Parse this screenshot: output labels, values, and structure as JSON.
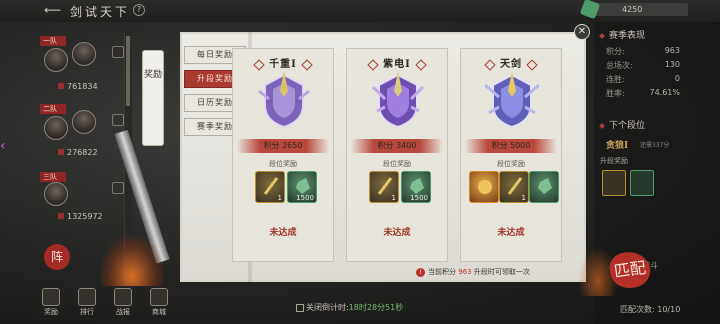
{
  "header": {
    "title": "剑试天下",
    "currency_value": "4250"
  },
  "teams": [
    {
      "tag": "一队",
      "score": "761834"
    },
    {
      "tag": "二队",
      "score": "276822"
    },
    {
      "tag": "三队",
      "score": "1325972"
    }
  ],
  "bottom_nav": [
    "奖励",
    "排行",
    "战报",
    "商城"
  ],
  "side_tab": {
    "label": "奖励"
  },
  "left_seal": "阵",
  "menu": [
    {
      "label": "每日奖励",
      "active": false
    },
    {
      "label": "升段奖励",
      "active": true
    },
    {
      "label": "日历奖励",
      "active": false
    },
    {
      "label": "赛季奖励",
      "active": false
    }
  ],
  "cards": [
    {
      "title": "千重Ⅰ",
      "score": "积分 2650",
      "reward_label": "段位奖励",
      "items": [
        {
          "count": "1",
          "type": "gold"
        },
        {
          "count": "1500",
          "type": "green"
        }
      ],
      "status": "未达成"
    },
    {
      "title": "紫电Ⅰ",
      "score": "积分 3400",
      "reward_label": "段位奖励",
      "items": [
        {
          "count": "1",
          "type": "gold"
        },
        {
          "count": "1500",
          "type": "green"
        }
      ],
      "status": "未达成"
    },
    {
      "title": "天剑",
      "score": "积分 5000",
      "reward_label": "段位奖励",
      "items": [
        {
          "count": "",
          "type": "orange"
        },
        {
          "count": "1",
          "type": "gold"
        },
        {
          "count": "",
          "type": "green"
        }
      ],
      "status": "未达成"
    }
  ],
  "notice": {
    "prefix": "当前积分",
    "points": "963",
    "suffix": "升段时可领取一次"
  },
  "countdown": {
    "label": "关闭倒计时:",
    "time": "18时28分51秒"
  },
  "season": {
    "title": "赛季表现",
    "stats": [
      {
        "label": "积分:",
        "value": "963"
      },
      {
        "label": "总场次:",
        "value": "130"
      },
      {
        "label": "连胜:",
        "value": "0"
      },
      {
        "label": "胜率:",
        "value": "74.61%"
      }
    ],
    "next_title": "下个段位",
    "next_rank": "贪狼Ⅰ",
    "next_need": "还需337分",
    "promo_label": "升段奖励",
    "skip_battle": "跳过战斗",
    "match_seal": "匹配",
    "match_count": "匹配次数: 10/10"
  },
  "colors": {
    "accent_red": "#a93a30",
    "gold_text": "#c7a35b",
    "green_time": "#77b86f"
  }
}
